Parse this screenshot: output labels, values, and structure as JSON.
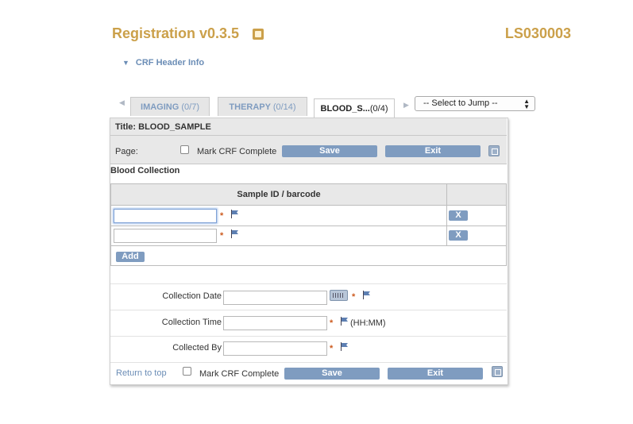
{
  "app": {
    "title": "Registration v0.3.5",
    "study_id": "LS030003"
  },
  "crf_header": {
    "label": "CRF Header Info",
    "arrow": "▼"
  },
  "tabs": {
    "prev_arrow": "◀",
    "next_arrow": "▶",
    "items": [
      {
        "label": "IMAGING",
        "count": "(0/7)"
      },
      {
        "label": "THERAPY",
        "count": "(0/14)"
      },
      {
        "label": "BLOOD_S...",
        "count": "(0/4)"
      }
    ],
    "jump_select": {
      "selected": "-- Select to Jump --"
    }
  },
  "crf": {
    "title": "Title: BLOOD_SAMPLE",
    "page_label": "Page:",
    "mark_complete_label": "Mark CRF Complete",
    "save_label": "Save",
    "exit_label": "Exit",
    "section_title": "Blood Collection",
    "table": {
      "column_header": "Sample ID / barcode",
      "rows": [
        {
          "value": "",
          "required": "*",
          "remove_label": "X"
        },
        {
          "value": "",
          "required": "*",
          "remove_label": "X"
        }
      ],
      "add_label": "Add"
    },
    "fields": {
      "collection_date": {
        "label": "Collection Date",
        "value": "",
        "required": "*"
      },
      "collection_time": {
        "label": "Collection Time",
        "value": "",
        "required": "*",
        "hint": "(HH:MM)"
      },
      "collected_by": {
        "label": "Collected By",
        "value": "",
        "required": "*"
      }
    },
    "footer": {
      "return_link": "Return to top",
      "mark_complete_label": "Mark CRF Complete",
      "save_label": "Save",
      "exit_label": "Exit"
    }
  },
  "colors": {
    "accent_gold": "#cba04a",
    "button_blue": "#7f9cc0",
    "link_blue": "#6b8db6",
    "required_orange": "#cc5a1e"
  }
}
